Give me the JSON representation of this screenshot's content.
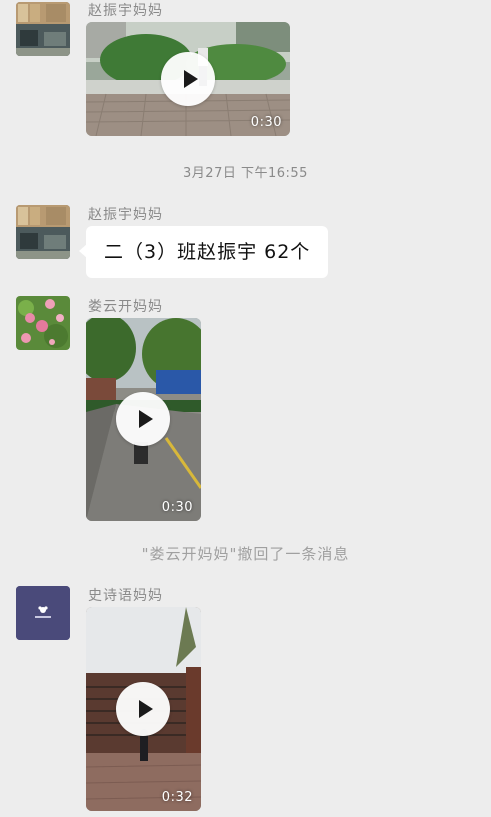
{
  "messages": [
    {
      "sender": "赵振宇妈妈",
      "type": "video",
      "duration": "0:30"
    },
    {
      "type": "timestamp",
      "text": "3月27日 下午16:55"
    },
    {
      "sender": "赵振宇妈妈",
      "type": "text",
      "text": "二（3）班赵振宇 62个"
    },
    {
      "sender": "娄云开妈妈",
      "type": "video",
      "duration": "0:30"
    },
    {
      "type": "system",
      "text": "\"娄云开妈妈\"撤回了一条消息"
    },
    {
      "sender": "史诗语妈妈",
      "type": "video",
      "duration": "0:32"
    }
  ],
  "colors": {
    "background": "#ededed",
    "bubble": "#ffffff",
    "sender_text": "#8a8a8a",
    "avatar_purple": "#4a4a7a"
  }
}
